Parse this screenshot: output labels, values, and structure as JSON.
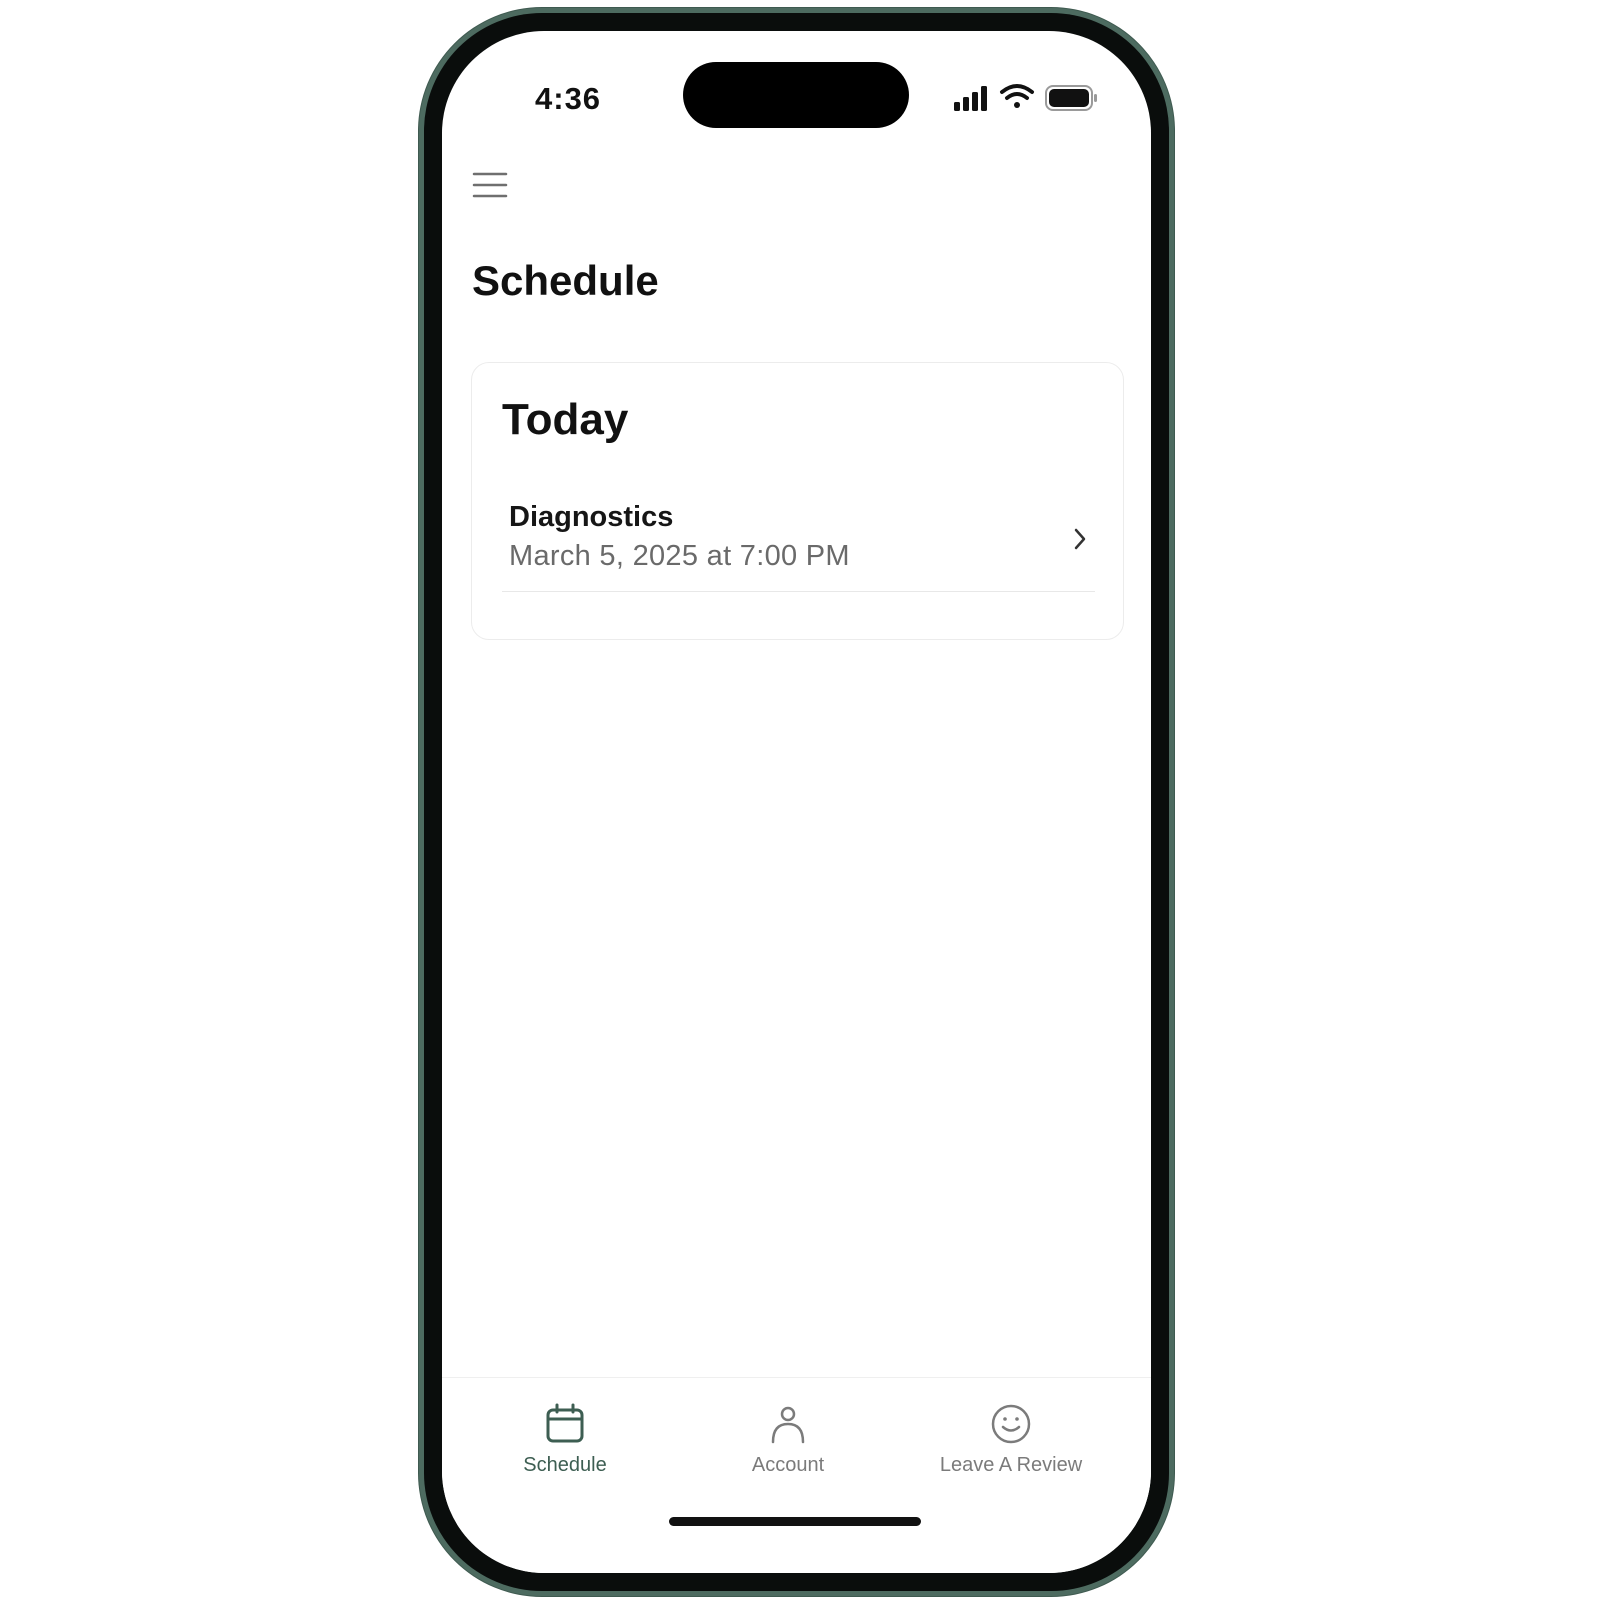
{
  "status_bar": {
    "time": "4:36",
    "icons": [
      "cellular-signal-icon",
      "wifi-icon",
      "battery-icon"
    ]
  },
  "header": {
    "menu_icon": "hamburger-menu-icon",
    "title": "Schedule"
  },
  "schedule_card": {
    "title": "Today",
    "appointments": [
      {
        "name": "Diagnostics",
        "datetime": "March 5, 2025 at 7:00 PM",
        "icon": "chevron-right-icon"
      }
    ]
  },
  "tab_bar": {
    "tabs": [
      {
        "label": "Schedule",
        "icon": "calendar-icon",
        "active": true
      },
      {
        "label": "Account",
        "icon": "person-icon",
        "active": false
      },
      {
        "label": "Leave A Review",
        "icon": "smiley-face-icon",
        "active": false
      }
    ]
  },
  "colors": {
    "accent": "#3d5e52",
    "frame": "#4d6b60",
    "text_primary": "#111111",
    "text_secondary": "#6a6a6a",
    "tab_inactive": "#7b7b7b"
  }
}
